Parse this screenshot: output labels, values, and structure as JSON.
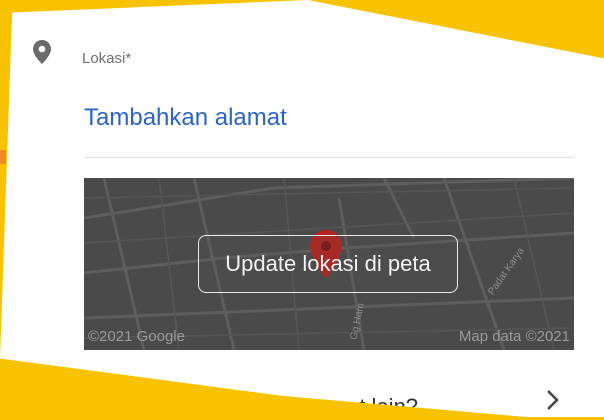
{
  "location": {
    "label": "Lokasi*",
    "add_address": "Tambahkan alamat"
  },
  "map": {
    "update_button": "Update lokasi di peta",
    "copyright": "©2021 Google",
    "map_data": "Map data ©2021",
    "streets": [
      "Padat Karya",
      "Gg Ham"
    ]
  },
  "next_row": {
    "text": "...t lain?"
  },
  "colors": {
    "background": "#f7c300",
    "link": "#2b64c5",
    "pin": "#6b6b6b",
    "marker": "#b8211d",
    "map": "#4a4a4a"
  },
  "icons": [
    "map-pin-icon",
    "map-marker-icon",
    "chevron-right-icon"
  ]
}
